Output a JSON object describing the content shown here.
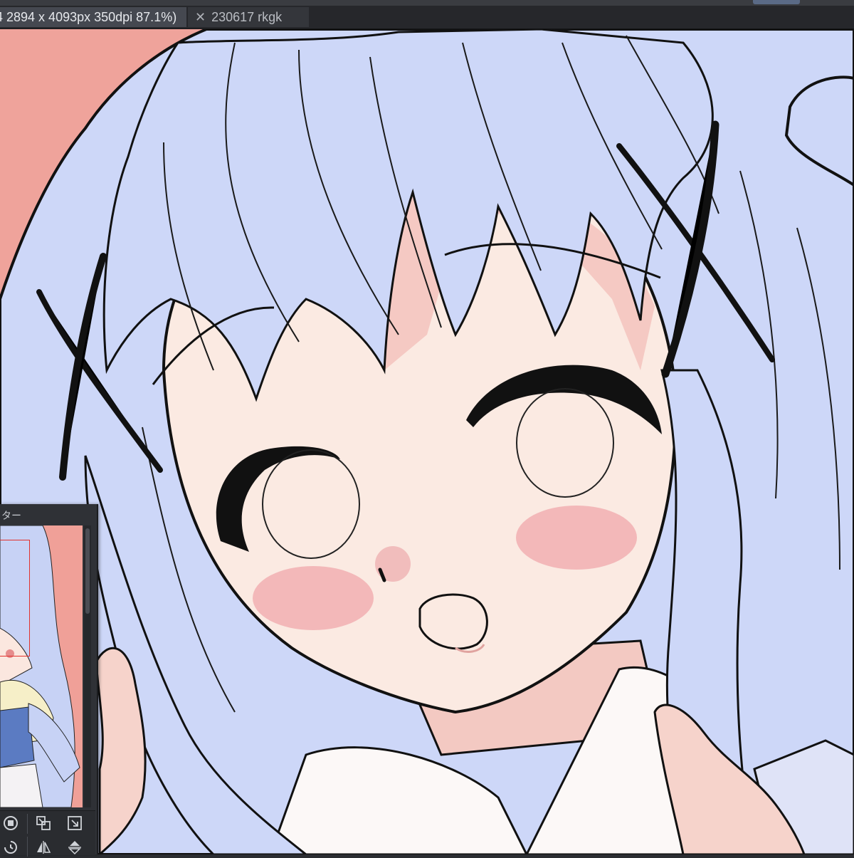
{
  "app": {
    "tabs": [
      {
        "label": "4 2894 x 4093px 350dpi 87.1%)",
        "active": true
      },
      {
        "label": "230617 rkgk",
        "active": false,
        "close_icon": "close-icon"
      }
    ]
  },
  "canvas": {
    "background_color": "#efa39b",
    "hair_color": "#cdd7f8",
    "skin_color": "#fbeae2",
    "blush_color": "#f0a7ab",
    "lineart_color": "#111111"
  },
  "navigator": {
    "title": "ター",
    "viewport_frame_color": "#e0322e",
    "tools": [
      {
        "name": "fit-view-icon"
      },
      {
        "name": "shrink-view-icon"
      },
      {
        "name": "expand-view-icon"
      },
      {
        "name": "rotate-view-icon"
      },
      {
        "name": "flip-horizontal-icon"
      },
      {
        "name": "flip-vertical-icon"
      }
    ]
  }
}
